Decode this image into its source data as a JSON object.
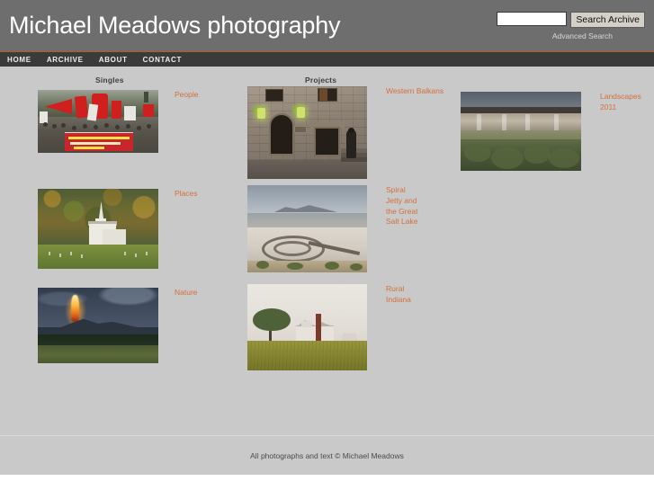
{
  "header": {
    "site_title": "Michael Meadows photography",
    "search": {
      "input_value": "",
      "placeholder": "",
      "button_label": "Search Archive",
      "advanced_label": "Advanced Search"
    }
  },
  "nav": {
    "items": [
      {
        "label": "HOME"
      },
      {
        "label": "ARCHIVE"
      },
      {
        "label": "ABOUT"
      },
      {
        "label": "CONTACT"
      }
    ]
  },
  "main": {
    "columns": {
      "singles_heading": "Singles",
      "projects_heading": "Projects"
    },
    "singles": [
      {
        "caption": "People",
        "image_alt": "Protest march with red flags and banner"
      },
      {
        "caption": "Places",
        "image_alt": "White wooden church with steeple in autumn forest"
      },
      {
        "caption": "Nature",
        "image_alt": "Volcanic eruption glowing over dark mountain at dusk"
      }
    ],
    "projects": [
      {
        "caption": "Western Balkans",
        "image_alt": "Stone building facade with green lanterns and arched doors"
      },
      {
        "caption": "Spiral Jetty and the Great Salt Lake",
        "image_alt": "Spiral Jetty earthwork on the Great Salt Lake shore"
      },
      {
        "caption": "Rural Indiana",
        "image_alt": "Farmhouse with silo and tree beyond a crop field"
      }
    ],
    "landscapes": [
      {
        "caption": "Landscapes 2011",
        "image_alt": "Eroded cliffs above sagebrush scrubland"
      }
    ]
  },
  "footer": {
    "copyright": "All photographs and text © Michael Meadows"
  },
  "colors": {
    "header_bg": "#6e6e6e",
    "nav_bg": "#3b3b3b",
    "accent_rule": "#b45a28",
    "page_bg": "#c9c9c9",
    "link_orange": "#d2703c"
  }
}
